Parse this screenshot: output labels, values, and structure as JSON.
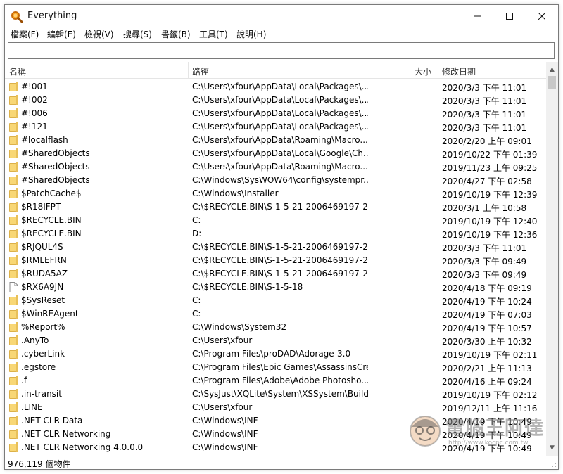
{
  "window": {
    "title": "Everything",
    "icon": "magnifier-icon"
  },
  "menu": [
    {
      "label": "檔案(F)"
    },
    {
      "label": "編輯(E)"
    },
    {
      "label": "檢視(V)"
    },
    {
      "label": "搜尋(S)"
    },
    {
      "label": "書籤(B)"
    },
    {
      "label": "工具(T)"
    },
    {
      "label": "說明(H)"
    }
  ],
  "search": {
    "value": "",
    "placeholder": ""
  },
  "columns": {
    "name": "名稱",
    "path": "路徑",
    "size": "大小",
    "modified": "修改日期"
  },
  "rows": [
    {
      "icon": "folder",
      "name": "#!001",
      "path": "C:\\Users\\xfour\\AppData\\Local\\Packages\\...",
      "modified": "2020/3/3 下午 11:01"
    },
    {
      "icon": "folder",
      "name": "#!002",
      "path": "C:\\Users\\xfour\\AppData\\Local\\Packages\\...",
      "modified": "2020/3/3 下午 11:01"
    },
    {
      "icon": "folder",
      "name": "#!006",
      "path": "C:\\Users\\xfour\\AppData\\Local\\Packages\\...",
      "modified": "2020/3/3 下午 11:01"
    },
    {
      "icon": "folder",
      "name": "#!121",
      "path": "C:\\Users\\xfour\\AppData\\Local\\Packages\\...",
      "modified": "2020/3/3 下午 11:01"
    },
    {
      "icon": "folder",
      "name": "#localflash",
      "path": "C:\\Users\\xfour\\AppData\\Roaming\\Macro...",
      "modified": "2020/2/20 上午 09:01"
    },
    {
      "icon": "folder",
      "name": "#SharedObjects",
      "path": "C:\\Users\\xfour\\AppData\\Local\\Google\\Ch...",
      "modified": "2019/10/22 下午 01:39"
    },
    {
      "icon": "folder",
      "name": "#SharedObjects",
      "path": "C:\\Users\\xfour\\AppData\\Roaming\\Macro...",
      "modified": "2019/11/23 上午 09:25"
    },
    {
      "icon": "folder",
      "name": "#SharedObjects",
      "path": "C:\\Windows\\SysWOW64\\config\\systempr...",
      "modified": "2020/4/27 下午 02:58"
    },
    {
      "icon": "folder",
      "name": "$PatchCache$",
      "path": "C:\\Windows\\Installer",
      "modified": "2019/10/19 下午 12:39"
    },
    {
      "icon": "folder",
      "name": "$R18IFPT",
      "path": "C:\\$RECYCLE.BIN\\S-1-5-21-2006469197-2...",
      "modified": "2020/3/1 上午 10:58"
    },
    {
      "icon": "folder",
      "name": "$RECYCLE.BIN",
      "path": "C:",
      "modified": "2019/10/19 下午 12:40"
    },
    {
      "icon": "folder",
      "name": "$RECYCLE.BIN",
      "path": "D:",
      "modified": "2019/10/19 下午 12:36"
    },
    {
      "icon": "folder",
      "name": "$RJQUL4S",
      "path": "C:\\$RECYCLE.BIN\\S-1-5-21-2006469197-2...",
      "modified": "2020/3/3 下午 11:01"
    },
    {
      "icon": "folder",
      "name": "$RMLEFRN",
      "path": "C:\\$RECYCLE.BIN\\S-1-5-21-2006469197-2...",
      "modified": "2020/3/3 下午 09:49"
    },
    {
      "icon": "folder",
      "name": "$RUDA5AZ",
      "path": "C:\\$RECYCLE.BIN\\S-1-5-21-2006469197-2...",
      "modified": "2020/3/3 下午 09:49"
    },
    {
      "icon": "file",
      "name": "$RX6A9JN",
      "path": "C:\\$RECYCLE.BIN\\S-1-5-18",
      "modified": "2020/4/18 下午 09:19"
    },
    {
      "icon": "folder",
      "name": "$SysReset",
      "path": "C:",
      "modified": "2020/4/19 下午 10:24"
    },
    {
      "icon": "folder",
      "name": "$WinREAgent",
      "path": "C:",
      "modified": "2020/4/19 下午 07:03"
    },
    {
      "icon": "folder",
      "name": "%Report%",
      "path": "C:\\Windows\\System32",
      "modified": "2020/4/19 下午 10:57"
    },
    {
      "icon": "folder",
      "name": ".AnyTo",
      "path": "C:\\Users\\xfour",
      "modified": "2020/3/30 上午 10:32"
    },
    {
      "icon": "folder",
      "name": ".cyberLink",
      "path": "C:\\Program Files\\proDAD\\Adorage-3.0",
      "modified": "2019/10/19 下午 02:11"
    },
    {
      "icon": "folder",
      "name": ".egstore",
      "path": "C:\\Program Files\\Epic Games\\AssassinsCre...",
      "modified": "2020/2/21 上午 11:13"
    },
    {
      "icon": "folder",
      "name": ".f",
      "path": "C:\\Program Files\\Adobe\\Adobe Photosho...",
      "modified": "2020/4/16 上午 09:24"
    },
    {
      "icon": "folder",
      "name": ".in-transit",
      "path": "C:\\SysJust\\XQLite\\System\\XSSystem\\Build...",
      "modified": "2019/10/19 下午 02:12"
    },
    {
      "icon": "folder",
      "name": ".LINE",
      "path": "C:\\Users\\xfour",
      "modified": "2019/12/11 上午 11:16"
    },
    {
      "icon": "folder",
      "name": ".NET CLR Data",
      "path": "C:\\Windows\\INF",
      "modified": "2020/4/19 下午 10:49"
    },
    {
      "icon": "folder",
      "name": ".NET CLR Networking",
      "path": "C:\\Windows\\INF",
      "modified": "2020/4/19 下午 10:49"
    },
    {
      "icon": "folder",
      "name": ".NET CLR Networking 4.0.0.0",
      "path": "C:\\Windows\\INF",
      "modified": "2020/4/19 下午 10:49"
    }
  ],
  "status": {
    "text": "976,119 個物件"
  },
  "watermark": {
    "brand": "電腦王阿達",
    "url": "http://www.kocpc.com.tw"
  },
  "colors": {
    "folder": "#f8d775",
    "accent": "#0078d7"
  }
}
